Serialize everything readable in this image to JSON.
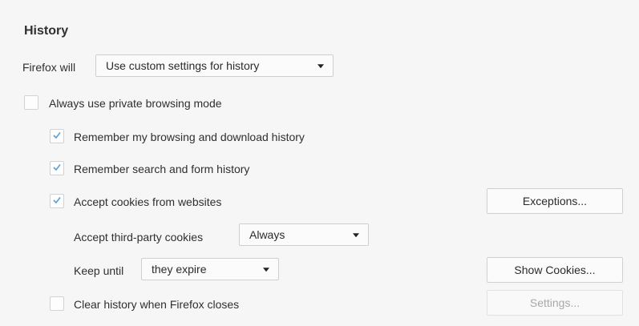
{
  "section": {
    "title": "History"
  },
  "firefox_will": {
    "label": "Firefox will",
    "selected": "Use custom settings for history"
  },
  "private_mode": {
    "label": "Always use private browsing mode",
    "checked": false
  },
  "remember_browsing": {
    "label": "Remember my browsing and download history",
    "checked": true
  },
  "remember_search": {
    "label": "Remember search and form history",
    "checked": true
  },
  "accept_cookies": {
    "label": "Accept cookies from websites",
    "checked": true
  },
  "exceptions_button": {
    "label": "Exceptions..."
  },
  "third_party": {
    "label": "Accept third-party cookies",
    "selected": "Always"
  },
  "keep_until": {
    "label": "Keep until",
    "selected": "they expire"
  },
  "show_cookies_button": {
    "label": "Show Cookies..."
  },
  "clear_history": {
    "label": "Clear history when Firefox closes",
    "checked": false
  },
  "settings_button": {
    "label": "Settings..."
  },
  "colors": {
    "check": "#5a9fd6",
    "disabled_text": "#a8a8a8"
  }
}
